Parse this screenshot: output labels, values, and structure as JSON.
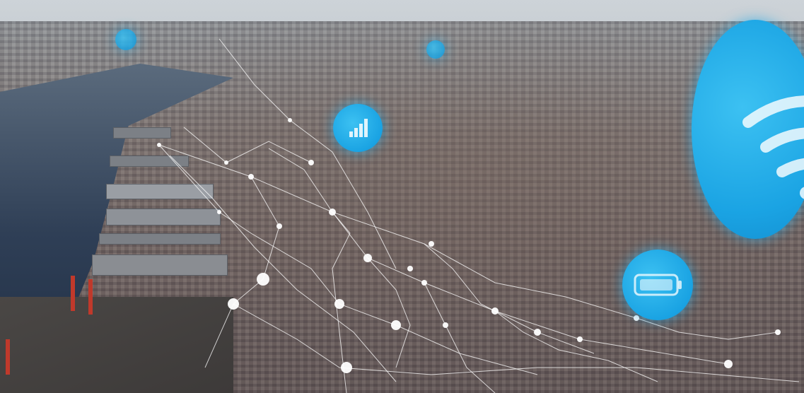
{
  "image": {
    "description_icons": [
      "signal-bars-icon",
      "wifi-icon",
      "battery-icon"
    ],
    "accent_color": "#1aa3e3"
  }
}
